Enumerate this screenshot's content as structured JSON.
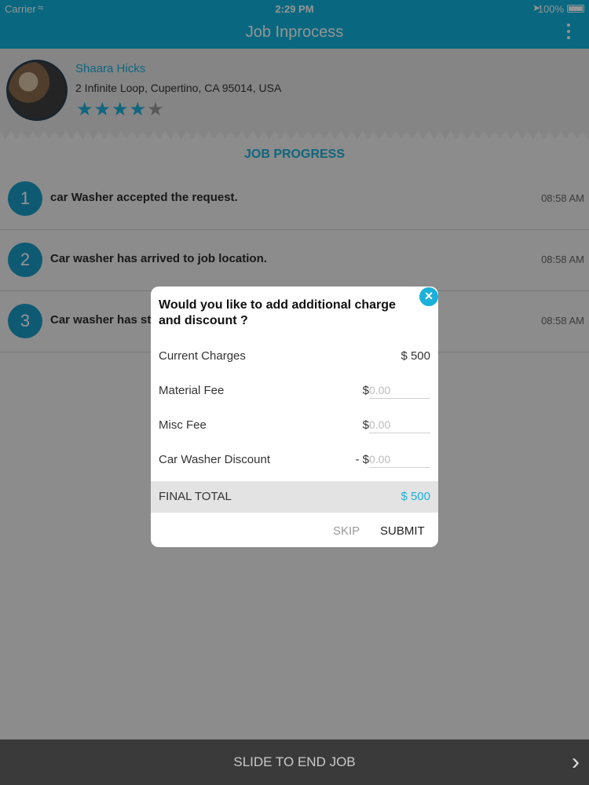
{
  "status_bar": {
    "carrier": "Carrier",
    "time": "2:29 PM",
    "battery": "100%"
  },
  "nav": {
    "title": "Job Inprocess"
  },
  "profile": {
    "name": "Shaara Hicks",
    "address": "2 Infinite Loop,  Cupertino,  CA 95014,  USA",
    "rating": 4,
    "rating_max": 5
  },
  "job_progress": {
    "title": "JOB PROGRESS",
    "steps": [
      {
        "number": "1",
        "text": "car Washer accepted the request.",
        "time": "08:58 AM"
      },
      {
        "number": "2",
        "text": "Car washer has arrived to job location.",
        "time": "08:58 AM"
      },
      {
        "number": "3",
        "text": "Car washer has sta",
        "time": "08:58 AM"
      }
    ]
  },
  "dialog": {
    "title": "Would you like to add additional charge and discount ?",
    "current_charges_label": "Current Charges",
    "current_charges_value": "$ 500",
    "material_fee_label": "Material Fee",
    "material_fee_currency": "$",
    "material_fee_placeholder": "0.00",
    "misc_fee_label": "Misc Fee",
    "misc_fee_currency": "$",
    "misc_fee_placeholder": "0.00",
    "discount_label": "Car Washer Discount",
    "discount_currency": "- $",
    "discount_placeholder": "0.00",
    "final_total_label": "FINAL TOTAL",
    "final_total_value": "$ 500",
    "skip_label": "SKIP",
    "submit_label": "SUBMIT"
  },
  "slide": {
    "label": "SLIDE TO END JOB"
  },
  "colors": {
    "accent": "#1ab0d9",
    "navbar": "#10b3dc",
    "slide_bar": "#3a3a3a"
  }
}
